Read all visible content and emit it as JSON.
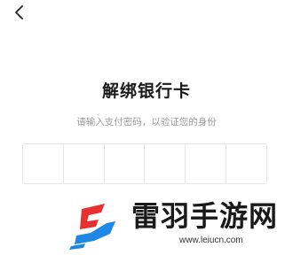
{
  "header": {
    "back_icon": "chevron-left-icon"
  },
  "main": {
    "title": "解绑银行卡",
    "subtitle": "请输入支付密码，以验证您的身份",
    "pin": {
      "length": 6,
      "values": [
        "",
        "",
        "",
        "",
        "",
        ""
      ]
    }
  },
  "watermark": {
    "brand": "雷羽手游网",
    "url": "www.leiucn.com",
    "colors": {
      "red": "#e8312f",
      "blue": "#1e88e5"
    }
  },
  "colors": {
    "background": "#ffffff",
    "title": "#1a1a1a",
    "subtitle": "#9a9a9a",
    "border": "#e6e6e6"
  }
}
